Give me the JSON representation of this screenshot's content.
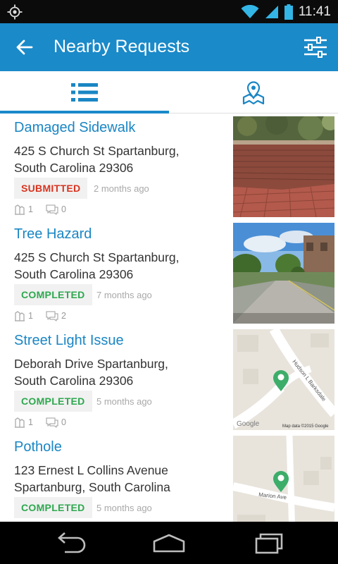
{
  "status_bar": {
    "time": "11:41",
    "icons": [
      "gps-icon",
      "wifi-icon",
      "signal-icon",
      "battery-icon"
    ]
  },
  "app_bar": {
    "title": "Nearby Requests",
    "back_icon": "arrow-left-icon",
    "filter_icon": "sliders-icon",
    "color": "#1a8ac9"
  },
  "tabs": [
    {
      "name": "list",
      "icon": "list-icon",
      "selected": true
    },
    {
      "name": "map",
      "icon": "map-pin-icon",
      "selected": false
    }
  ],
  "requests": [
    {
      "title": "Damaged Sidewalk",
      "address_line1": "425  S Church St Spartanburg,",
      "address_line2": "South Carolina 29306",
      "status": "SUBMITTED",
      "status_color": "#d8341f",
      "time_ago": "2 months ago",
      "likes": "1",
      "comments": "0",
      "thumbnail": "photo-brick-sidewalk"
    },
    {
      "title": "Tree Hazard",
      "address_line1": "425  S Church St Spartanburg,",
      "address_line2": "South Carolina 29306",
      "status": "COMPLETED",
      "status_color": "#2ea84f",
      "time_ago": "7 months ago",
      "likes": "1",
      "comments": "2",
      "thumbnail": "photo-street-trees"
    },
    {
      "title": "Street Light Issue",
      "address_line1": "Deborah Drive Spartanburg,",
      "address_line2": "South Carolina 29306",
      "status": "COMPLETED",
      "status_color": "#2ea84f",
      "time_ago": "5 months ago",
      "likes": "1",
      "comments": "0",
      "thumbnail": "map-thumbnail",
      "map_labels": {
        "street": "Hudson L Barksdale",
        "google": "Google",
        "copyright": "Map data ©2015 Google"
      }
    },
    {
      "title": "Pothole",
      "address_line1": "123  Ernest L Collins Avenue",
      "address_line2": "Spartanburg, South Carolina",
      "status": "COMPLETED",
      "status_color": "#2ea84f",
      "time_ago": "5 months ago",
      "thumbnail": "map-thumbnail",
      "map_labels": {
        "street": "Marion Ave"
      }
    }
  ],
  "nav_bar": {
    "buttons": [
      "back-nav-icon",
      "home-nav-icon",
      "recents-nav-icon"
    ]
  }
}
